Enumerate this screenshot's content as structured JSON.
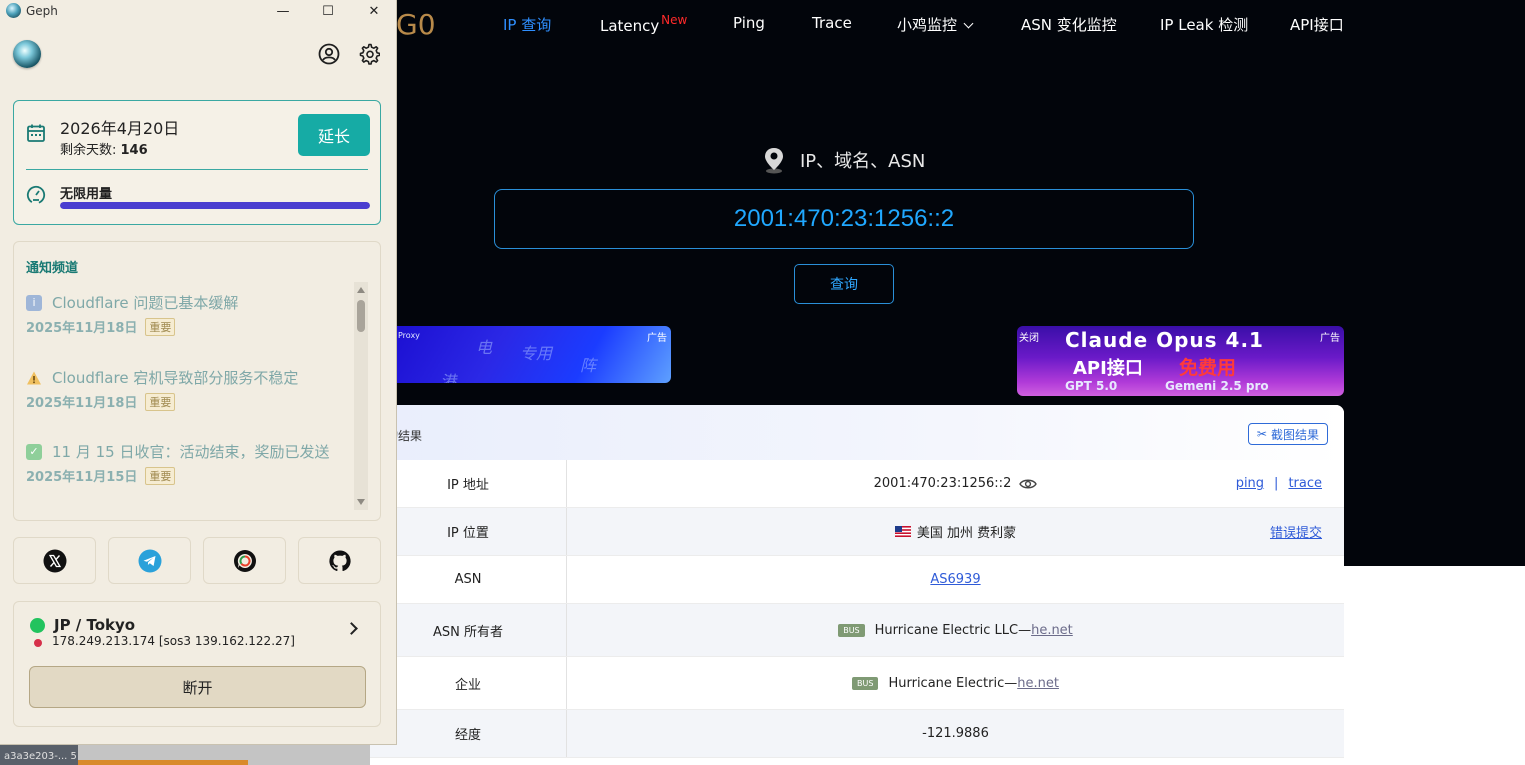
{
  "website": {
    "logo_fragment": "G0",
    "nav": [
      {
        "label": "IP 查询",
        "active": true
      },
      {
        "label": "Latency",
        "badge": "New"
      },
      {
        "label": "Ping"
      },
      {
        "label": "Trace"
      },
      {
        "label": "小鸡监控",
        "dropdown": true
      },
      {
        "label": "ASN 变化监控"
      },
      {
        "label": "IP Leak 检测"
      },
      {
        "label": "API接口"
      }
    ],
    "search_label": "IP、域名、ASN",
    "search_value": "2001:470:23:1256::2",
    "query_button": "查询",
    "ad_left": {
      "tag": "广告",
      "small_text": "Proxy",
      "words": [
        "电",
        "专用",
        "阵",
        "港"
      ]
    },
    "ad_right": {
      "tag": "广告",
      "close": "关闭",
      "line1": "Claude Opus 4.1",
      "line2_a": "API接口",
      "line2_b": "免费用",
      "line3_a": "GPT 5.0",
      "line3_b": "Gemeni 2.5 pro"
    },
    "results": {
      "title": "询结果",
      "screenshot_button": "截图结果",
      "rows": {
        "ip_address": {
          "key": "IP 地址",
          "value": "2001:470:23:1256::2",
          "link_ping": "ping",
          "separator": "|",
          "link_trace": "trace"
        },
        "ip_location": {
          "key": "IP 位置",
          "value": "美国 加州 费利蒙",
          "link_report": "错误提交"
        },
        "asn": {
          "key": "ASN",
          "value": "AS6939"
        },
        "asn_owner": {
          "key": "ASN 所有者",
          "badge": "BUS",
          "value": "Hurricane Electric LLC—",
          "link": "he.net"
        },
        "company": {
          "key": "企业",
          "badge": "BUS",
          "value": "Hurricane Electric—",
          "link": "he.net"
        },
        "longitude": {
          "key": "经度",
          "value": "-121.9886"
        }
      }
    }
  },
  "taskbar": {
    "fragment": "a3a3e203-... 5"
  },
  "geph": {
    "window_title": "Geph",
    "window_buttons": {
      "minimize": "—",
      "maximize": "☐",
      "close": "✕"
    },
    "subscription": {
      "expiry_date": "2026年4月20日",
      "remaining_label": "剩余天数: ",
      "remaining_days": "146",
      "extend_button": "延长",
      "usage_label": "无限用量",
      "usage_fraction": 1.0
    },
    "notifications": {
      "header": "通知频道",
      "items": [
        {
          "icon": "info-icon",
          "title": "Cloudflare 问题已基本缓解",
          "date": "2025年11月18日",
          "tag": "重要"
        },
        {
          "icon": "warning-icon",
          "title": "Cloudflare 宕机导致部分服务不稳定",
          "date": "2025年11月18日",
          "tag": "重要"
        },
        {
          "icon": "check-icon",
          "title": "11 月 15 日收官：活动结束，奖励已发送",
          "date": "2025年11月15日",
          "tag": "重要"
        }
      ]
    },
    "social": [
      "x-icon",
      "telegram-icon",
      "chat-icon",
      "github-icon"
    ],
    "connection": {
      "location": "JP / Tokyo",
      "server": "178.249.213.174 [sos3 139.162.122.27]",
      "status_color": "#22c35e",
      "disconnect_button": "断开"
    },
    "colors": {
      "accent": "#16aba5",
      "usage_bar": "#4a3ed0",
      "background": "#f2ede2"
    }
  }
}
